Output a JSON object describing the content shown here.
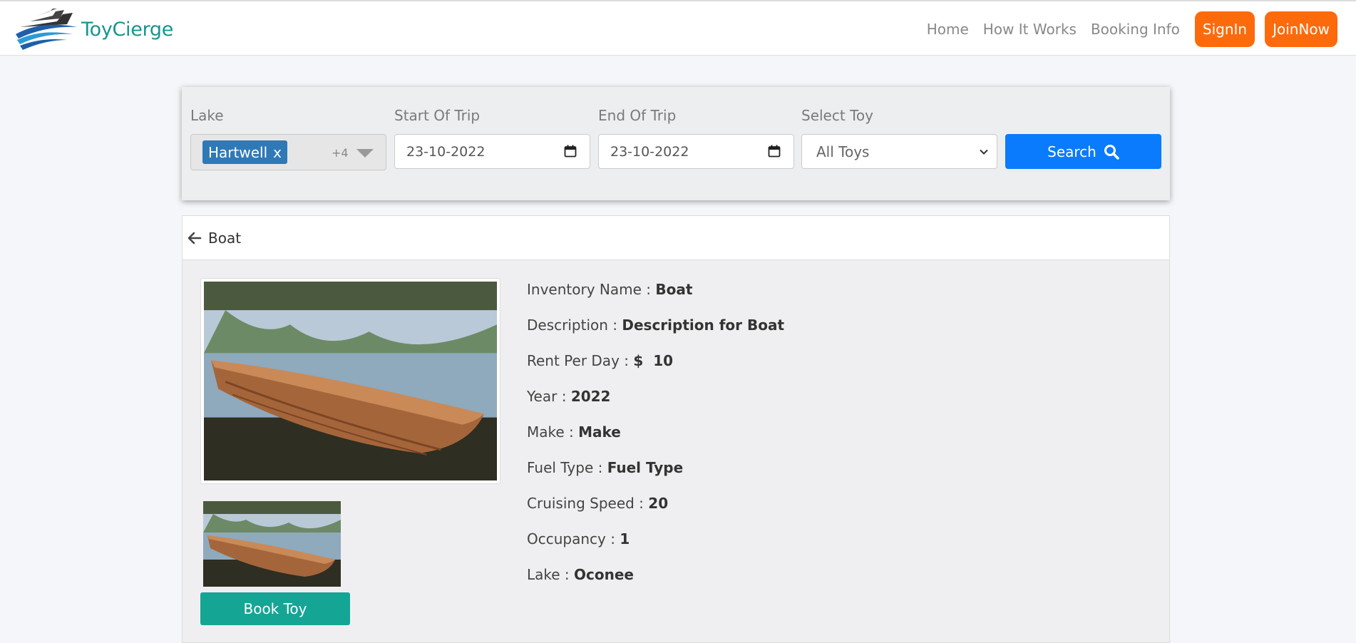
{
  "brand": {
    "name": "ToyCierge"
  },
  "nav": {
    "links": [
      "Home",
      "How It Works",
      "Booking Info"
    ],
    "signin": "SignIn",
    "joinnow": "JoinNow"
  },
  "search": {
    "lake_label": "Lake",
    "lake_selected": "Hartwell",
    "lake_chip_remove": "x",
    "lake_more": "+4",
    "start_label": "Start Of Trip",
    "start_value": "23-10-2022",
    "end_label": "End Of Trip",
    "end_value": "23-10-2022",
    "toy_label": "Select Toy",
    "toy_value": "All Toys",
    "button": "Search"
  },
  "detail": {
    "title": "Boat",
    "book_button": "Book Toy",
    "fields": [
      {
        "label": "Inventory Name :",
        "value": "Boat"
      },
      {
        "label": "Description :",
        "value": "Description for Boat"
      },
      {
        "label": "Rent Per Day :",
        "value": "$  10"
      },
      {
        "label": "Year :",
        "value": "2022"
      },
      {
        "label": "Make :",
        "value": "Make"
      },
      {
        "label": "Fuel Type :",
        "value": "Fuel Type"
      },
      {
        "label": "Cruising Speed :",
        "value": "20"
      },
      {
        "label": "Occupancy :",
        "value": "1"
      },
      {
        "label": "Lake :",
        "value": "Oconee"
      }
    ]
  },
  "colors": {
    "accent_orange": "#fd6a0c",
    "search_blue": "#0a7bfc",
    "book_teal": "#15a595",
    "brand_teal": "#17958d",
    "chip_blue": "#2f79b7"
  },
  "icons": [
    "boat-logo-icon",
    "calendar-icon",
    "chevron-down-icon",
    "search-icon",
    "arrow-left-icon"
  ]
}
